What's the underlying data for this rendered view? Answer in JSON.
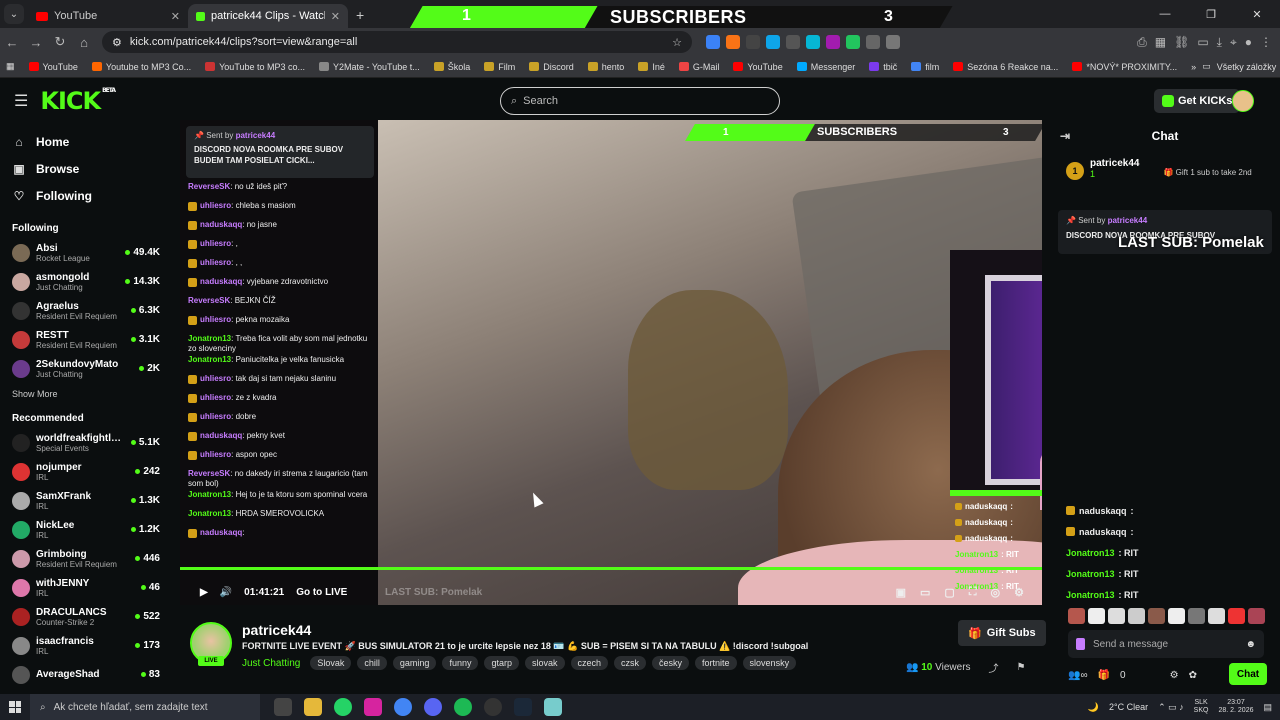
{
  "browser": {
    "tabs": [
      {
        "label": "YouTube",
        "active": false
      },
      {
        "label": "patricek44 Clips - Watch Live o",
        "active": true
      }
    ],
    "url": "kick.com/patricek44/clips?sort=view&range=all",
    "bookmarks": [
      "YouTube",
      "Youtube to MP3 Co...",
      "YouTube to MP3 co...",
      "Y2Mate - YouTube t...",
      "Škola",
      "Film",
      "Discord",
      "hento",
      "Iné",
      "G-Mail",
      "YouTube",
      "Messenger",
      "tbič",
      "film",
      "Sezóna 6 Reakce na...",
      "*NOVÝ* PROXIMITY..."
    ],
    "bookmarks_right": "Všetky záložky"
  },
  "sub_banner": {
    "left": "1",
    "label": "SUBSCRIBERS",
    "right": "3"
  },
  "header": {
    "logo": "KICK",
    "logo_sup": "BETA",
    "search_placeholder": "Search",
    "get_kicks": "Get KICKs"
  },
  "sidebar": {
    "nav": [
      {
        "label": "Home",
        "icon": "home-icon"
      },
      {
        "label": "Browse",
        "icon": "browse-icon"
      },
      {
        "label": "Following",
        "icon": "heart-icon"
      }
    ],
    "following_title": "Following",
    "following": [
      {
        "name": "Absi",
        "category": "Rocket League",
        "viewers": "49.4K",
        "color": "#7a6a55"
      },
      {
        "name": "asmongold",
        "category": "Just Chatting",
        "viewers": "14.3K",
        "color": "#c9a7a0"
      },
      {
        "name": "Agraelus",
        "category": "Resident Evil Requiem",
        "viewers": "6.3K",
        "color": "#333"
      },
      {
        "name": "RESTT",
        "category": "Resident Evil Requiem",
        "viewers": "3.1K",
        "color": "#c43a3a"
      },
      {
        "name": "2SekundovyMato",
        "category": "Just Chatting",
        "viewers": "2K",
        "color": "#6b3b8c"
      }
    ],
    "show_more": "Show More",
    "recommended_title": "Recommended",
    "recommended": [
      {
        "name": "worldfreakfightle...",
        "category": "Special Events",
        "viewers": "5.1K",
        "color": "#222"
      },
      {
        "name": "nojumper",
        "category": "IRL",
        "viewers": "242",
        "color": "#d33"
      },
      {
        "name": "SamXFrank",
        "category": "IRL",
        "viewers": "1.3K",
        "color": "#aaa"
      },
      {
        "name": "NickLee",
        "category": "IRL",
        "viewers": "1.2K",
        "color": "#2a6"
      },
      {
        "name": "Grimboing",
        "category": "Resident Evil Requiem",
        "viewers": "446",
        "color": "#c9a"
      },
      {
        "name": "withJENNY",
        "category": "IRL",
        "viewers": "46",
        "color": "#d7a"
      },
      {
        "name": "DRACULANCS",
        "category": "Counter-Strike 2",
        "viewers": "522",
        "color": "#a22"
      },
      {
        "name": "isaacfrancis",
        "category": "IRL",
        "viewers": "173",
        "color": "#888"
      },
      {
        "name": "AverageShad",
        "category": "",
        "viewers": "83",
        "color": "#555"
      }
    ]
  },
  "player": {
    "overlay_sub": {
      "left": "1",
      "label": "SUBSCRIBERS",
      "right": "3"
    },
    "pinned": {
      "sent_by": "Sent by",
      "user": "patricek44",
      "message": "DISCORD NOVA ROOMKA PRE SUBOV BUDEM TAM POSIELAT CICKI..."
    },
    "chat": [
      {
        "user": "ReverseSK",
        "text": "no už ideš piť?",
        "badge": false,
        "color": "#c77dff"
      },
      {
        "user": "uhliesro",
        "text": "chleba s masiom",
        "badge": true,
        "color": "#c77dff"
      },
      {
        "user": "naduskaqq",
        "text": "no jasne",
        "badge": true,
        "color": "#c77dff"
      },
      {
        "user": "uhliesro",
        "text": ",",
        "badge": true,
        "color": "#c77dff"
      },
      {
        "user": "uhliesro",
        "text": ", ,",
        "badge": true,
        "color": "#c77dff"
      },
      {
        "user": "naduskaqq",
        "text": "vyjebane zdravotnictvo",
        "badge": true,
        "color": "#c77dff"
      },
      {
        "user": "ReverseSK",
        "text": "BEJKN ČÍŽ",
        "badge": false,
        "color": "#c77dff"
      },
      {
        "user": "uhliesro",
        "text": "pekna mozaika",
        "badge": true,
        "color": "#c77dff"
      },
      {
        "user": "Jonatron13",
        "text": "Treba fica volit aby som mal jednotku zo slovenciny",
        "badge": false,
        "color": "#53fc18"
      },
      {
        "user": "Jonatron13",
        "text": "Paniucitelka je velka fanusicka",
        "badge": false,
        "color": "#53fc18"
      },
      {
        "user": "uhliesro",
        "text": "tak daj si tam nejaku slaninu",
        "badge": true,
        "color": "#c77dff"
      },
      {
        "user": "uhliesro",
        "text": "ze z kvadra",
        "badge": true,
        "color": "#c77dff"
      },
      {
        "user": "uhliesro",
        "text": "dobre",
        "badge": true,
        "color": "#c77dff"
      },
      {
        "user": "naduskaqq",
        "text": "pekny kvet",
        "badge": true,
        "color": "#c77dff"
      },
      {
        "user": "uhliesro",
        "text": "aspon opec",
        "badge": true,
        "color": "#c77dff"
      },
      {
        "user": "ReverseSK",
        "text": "no dakedy iri strema z laugaricio (tam som bol)",
        "badge": false,
        "color": "#c77dff"
      },
      {
        "user": "Jonatron13",
        "text": "Hej to je ta ktoru som spominal vcera",
        "badge": false,
        "color": "#53fc18"
      },
      {
        "user": "Jonatron13",
        "text": "HRDA SMEROVOLICKA",
        "badge": false,
        "color": "#53fc18"
      },
      {
        "user": "naduskaqq",
        "text": "",
        "badge": true,
        "color": "#c77dff"
      }
    ],
    "feed": [
      {
        "user": "naduskaqq",
        "text": ":",
        "badge": true
      },
      {
        "user": "naduskaqq",
        "text": ":",
        "badge": true
      },
      {
        "user": "naduskaqq",
        "text": ":",
        "badge": true
      },
      {
        "user": "Jonatron13",
        "text": ": RIT",
        "badge": false
      },
      {
        "user": "Jonatron13",
        "text": ": RIT",
        "badge": false
      },
      {
        "user": "Jonatron13",
        "text": ": RIT",
        "badge": false
      }
    ],
    "last_sub": "LAST SUB: Pomelak",
    "time": "01:41:21",
    "go_live": "Go to LIVE"
  },
  "chat_panel": {
    "title": "Chat",
    "gifter": {
      "name": "patricek44",
      "count": "1",
      "rank": "1",
      "message": "Gift 1 sub to take 2nd"
    },
    "pinned": {
      "sent_by": "Sent by",
      "user": "patricek44",
      "message": "DISCORD NOVA ROOMKA PRE SUBOV"
    },
    "last_sub": "LAST SUB: Pomelak",
    "messages": [
      {
        "user": "naduskaqq",
        "text": ":",
        "badge": true
      },
      {
        "user": "naduskaqq",
        "text": ":",
        "badge": true
      },
      {
        "user": "Jonatron13",
        "text": ": RIT",
        "badge": false
      },
      {
        "user": "Jonatron13",
        "text": ": RIT",
        "badge": false
      },
      {
        "user": "Jonatron13",
        "text": ": RIT",
        "badge": false
      }
    ],
    "send_placeholder": "Send a message",
    "kicks_count": "0",
    "chat_button": "Chat"
  },
  "streamer": {
    "name": "patricek44",
    "live_label": "LIVE",
    "title": "FORTNITE LIVE EVENT 🚀 BUS SIMULATOR 21 to je urcite lepsie nez 18 🪪 💪 SUB = PISEM SI TA NA TABULU ⚠️ !discord !subgoal",
    "category": "Just Chatting",
    "tags": [
      "Slovak",
      "chill",
      "gaming",
      "funny",
      "gtarp",
      "slovak",
      "czech",
      "czsk",
      "česky",
      "fortnite",
      "slovensky"
    ],
    "gift_subs": "Gift Subs",
    "viewers": "10",
    "viewers_label": "Viewers"
  },
  "taskbar": {
    "search_placeholder": "Ak chcete hľadať, sem zadajte text",
    "weather": "2°C  Clear",
    "lang": [
      "SLK",
      "SKQ"
    ],
    "time": "23:07",
    "date": "28. 2. 2026"
  },
  "colors": {
    "kick_green": "#53fc18",
    "background": "#0b0e0f"
  }
}
